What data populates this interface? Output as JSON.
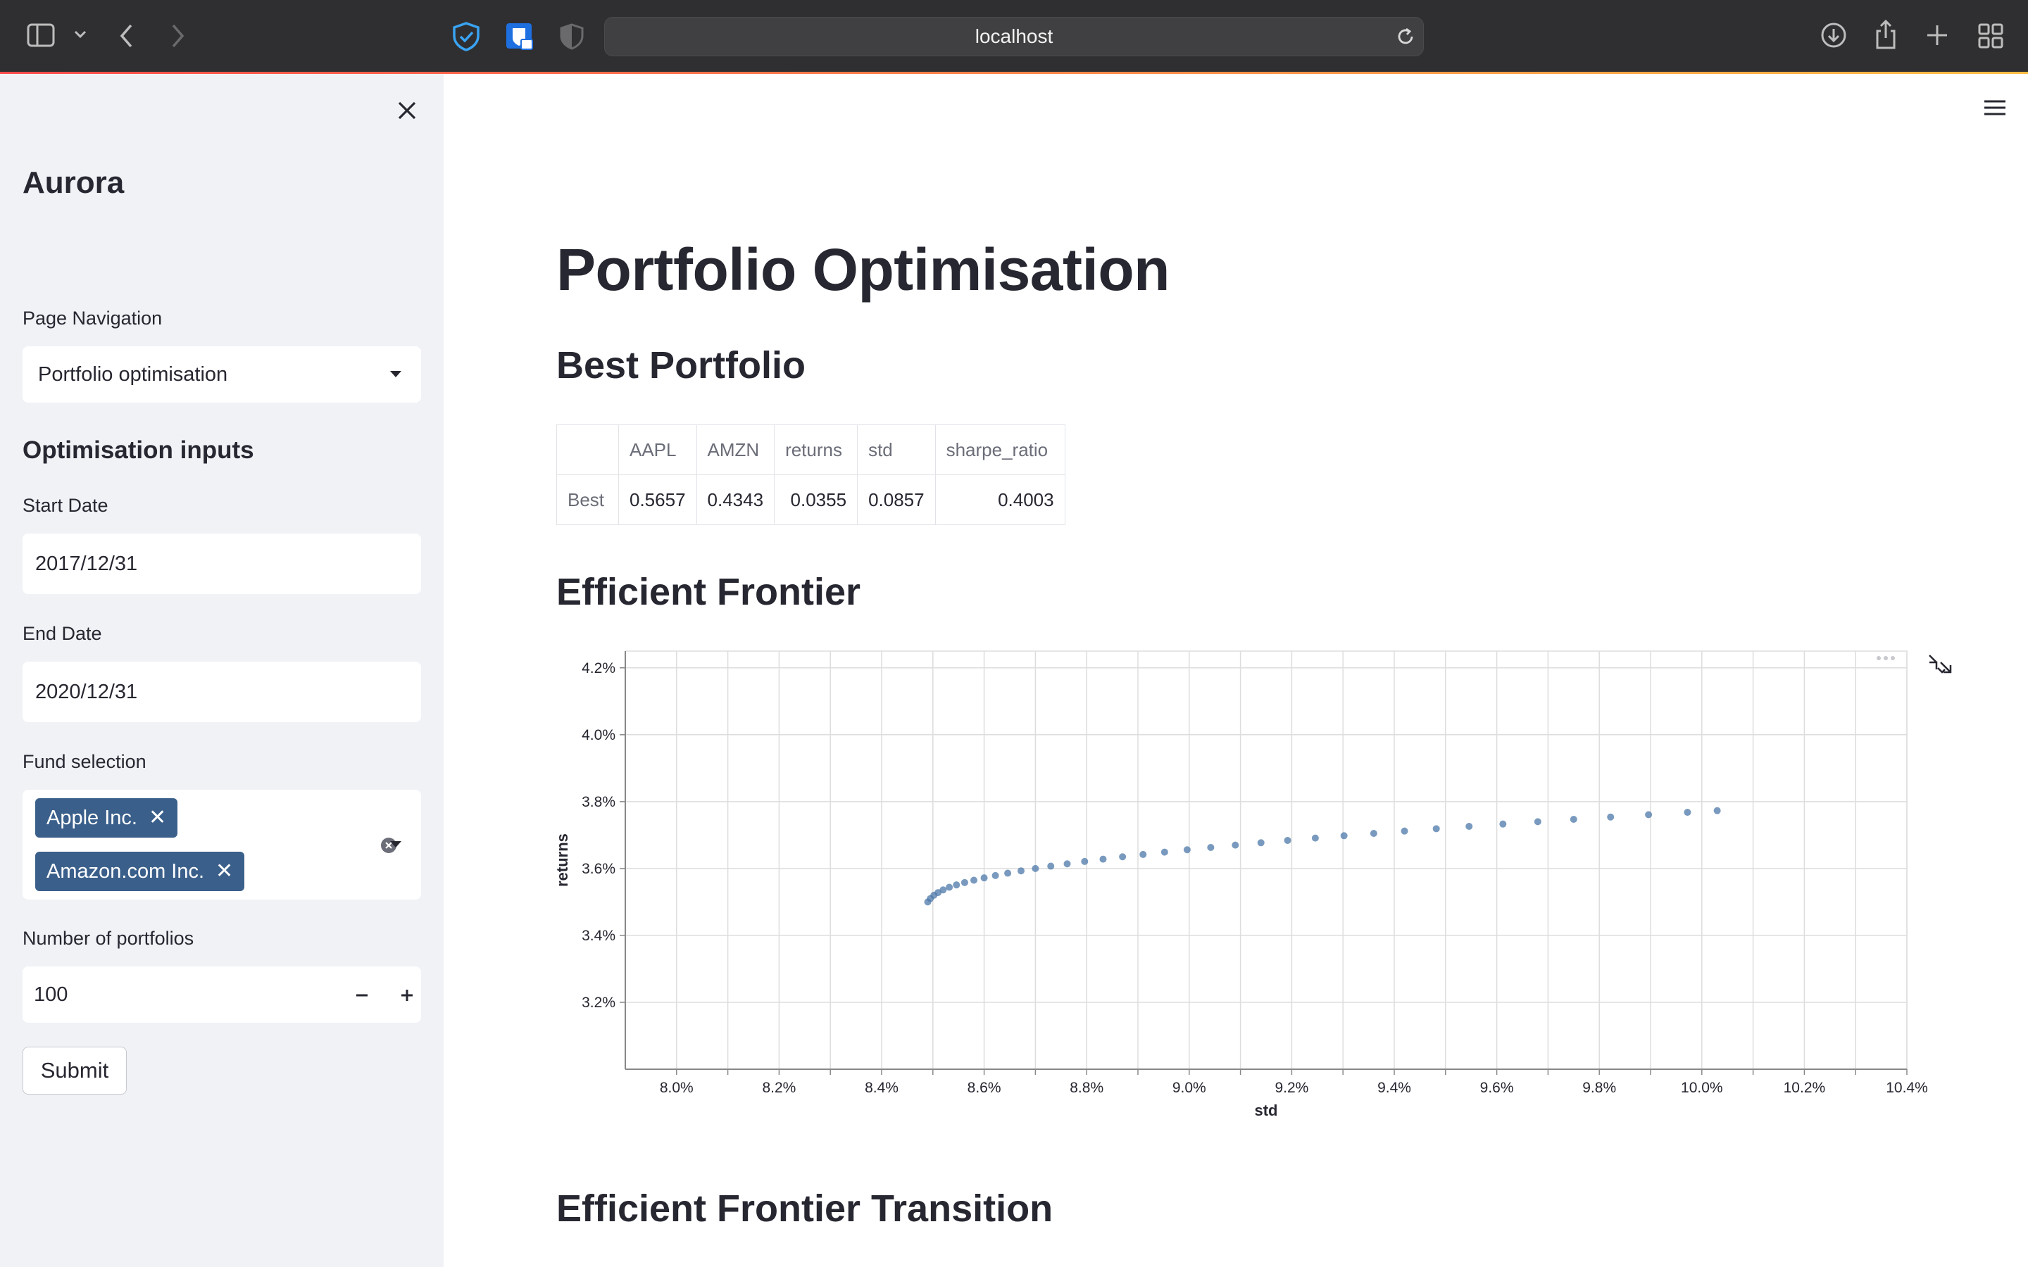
{
  "browser": {
    "url": "localhost"
  },
  "sidebar": {
    "app_title": "Aurora",
    "nav_label": "Page Navigation",
    "nav_selected": "Portfolio optimisation",
    "section_title": "Optimisation inputs",
    "start_label": "Start Date",
    "start_value": "2017/12/31",
    "end_label": "End Date",
    "end_value": "2020/12/31",
    "fund_label": "Fund selection",
    "funds": [
      "Apple Inc.",
      "Amazon.com Inc."
    ],
    "portfolios_label": "Number of portfolios",
    "portfolios_value": "100",
    "submit_label": "Submit"
  },
  "main": {
    "title": "Portfolio Optimisation",
    "best_heading": "Best Portfolio",
    "frontier_heading": "Efficient Frontier",
    "transition_heading": "Efficient Frontier Transition",
    "table": {
      "columns": [
        "",
        "AAPL",
        "AMZN",
        "returns",
        "std",
        "sharpe_ratio"
      ],
      "rows": [
        [
          "Best",
          "0.5657",
          "0.4343",
          "0.0355",
          "0.0857",
          "0.4003"
        ]
      ]
    }
  },
  "colors": {
    "accent": "#ff4b4b",
    "point": "#4c78a8",
    "tag": "#3a5f8a",
    "sidebar_bg": "#f0f2f6"
  },
  "chart_data": {
    "type": "scatter",
    "title": "",
    "xlabel": "std",
    "ylabel": "returns",
    "xlim": [
      0.079,
      0.104
    ],
    "ylim": [
      0.03,
      0.0425
    ],
    "x_ticks": [
      "8.0%",
      "8.2%",
      "8.4%",
      "8.6%",
      "8.8%",
      "9.0%",
      "9.2%",
      "9.4%",
      "9.6%",
      "9.8%",
      "10.0%",
      "10.2%",
      "10.4%"
    ],
    "y_ticks": [
      "3.2%",
      "3.4%",
      "3.6%",
      "3.8%",
      "4.0%",
      "4.2%"
    ],
    "grid": true,
    "series": [
      {
        "x": [
          0.0849,
          0.08495,
          0.08502,
          0.0851,
          0.0852,
          0.08532,
          0.08546,
          0.08562,
          0.0858,
          0.086,
          0.08622,
          0.08646,
          0.08672,
          0.087,
          0.0873,
          0.08762,
          0.08796,
          0.08832,
          0.0887,
          0.0891,
          0.08952,
          0.08996,
          0.09042,
          0.0909,
          0.0914,
          0.09192,
          0.09246,
          0.09302,
          0.0936,
          0.0942,
          0.09482,
          0.09546,
          0.09612,
          0.0968,
          0.0975,
          0.09822,
          0.09896,
          0.09972,
          0.1003
        ],
        "y": [
          0.035,
          0.0351,
          0.0352,
          0.03528,
          0.03536,
          0.03544,
          0.03551,
          0.03558,
          0.03565,
          0.03572,
          0.03579,
          0.03586,
          0.03593,
          0.036,
          0.03607,
          0.03614,
          0.03621,
          0.03628,
          0.03635,
          0.03642,
          0.03649,
          0.03656,
          0.03663,
          0.0367,
          0.03677,
          0.03684,
          0.03691,
          0.03698,
          0.03705,
          0.03712,
          0.03719,
          0.03726,
          0.03733,
          0.0374,
          0.03747,
          0.03754,
          0.03761,
          0.03768,
          0.03773
        ]
      }
    ]
  }
}
